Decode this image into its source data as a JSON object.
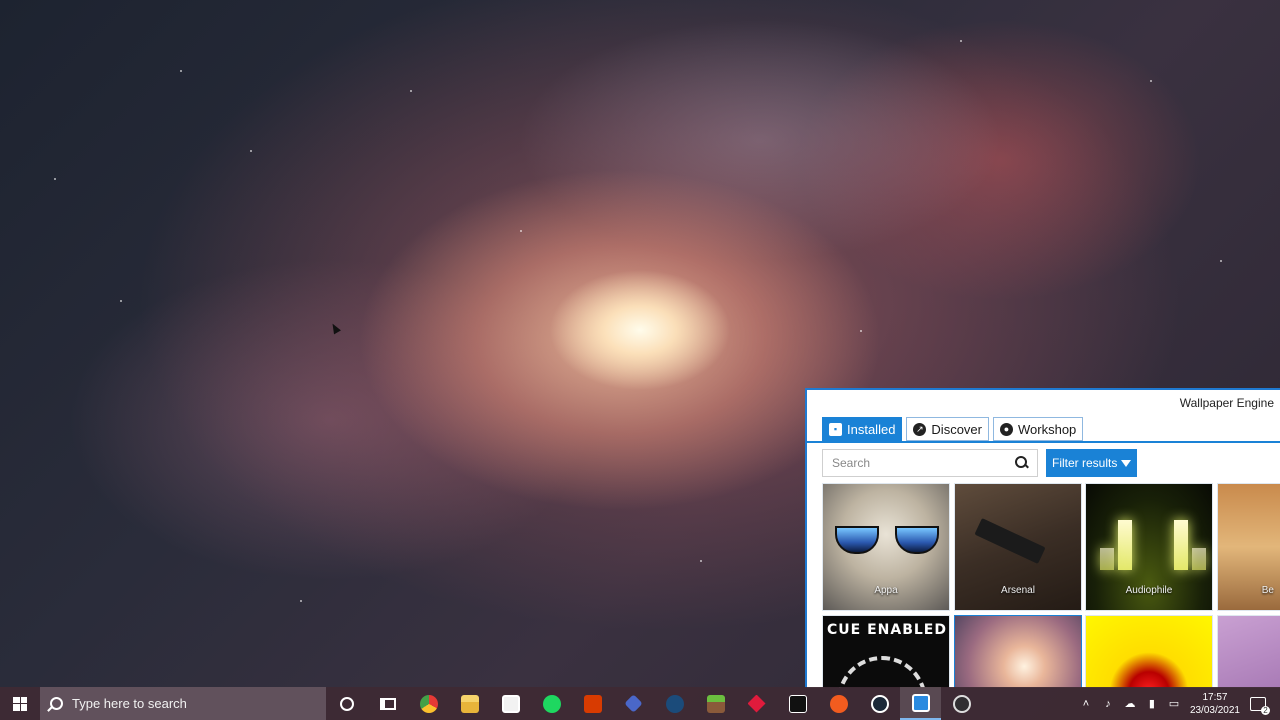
{
  "desktop": {
    "wallpaper": "galaxy"
  },
  "wallpaper_engine": {
    "title": "Wallpaper Engine",
    "tabs": [
      {
        "label": "Installed",
        "icon": "save-icon",
        "active": true
      },
      {
        "label": "Discover",
        "icon": "compass-icon",
        "active": false
      },
      {
        "label": "Workshop",
        "icon": "steam-icon",
        "active": false
      }
    ],
    "search": {
      "placeholder": "Search",
      "value": ""
    },
    "filter_label": "Filter results",
    "tiles_row1": [
      {
        "label": "Appa"
      },
      {
        "label": "Arsenal"
      },
      {
        "label": "Audiophile"
      },
      {
        "label": "Be"
      }
    ],
    "cue_text": "CUE ENABLED"
  },
  "taskbar": {
    "search_placeholder": "Type here to search",
    "apps": [
      "cortana-icon",
      "task-view-icon",
      "chrome-icon",
      "file-explorer-icon",
      "store-icon",
      "spotify-icon",
      "office-icon",
      "app-icon",
      "steam-icon",
      "minecraft-icon",
      "app-icon",
      "mw-icon",
      "app-icon",
      "steam-icon",
      "wallpaper-engine-icon",
      "obs-icon"
    ],
    "clock": {
      "time": "17:57",
      "date": "23/03/2021"
    }
  },
  "colors": {
    "accent": "#1a82d6",
    "taskbar": "#3e2a34"
  }
}
